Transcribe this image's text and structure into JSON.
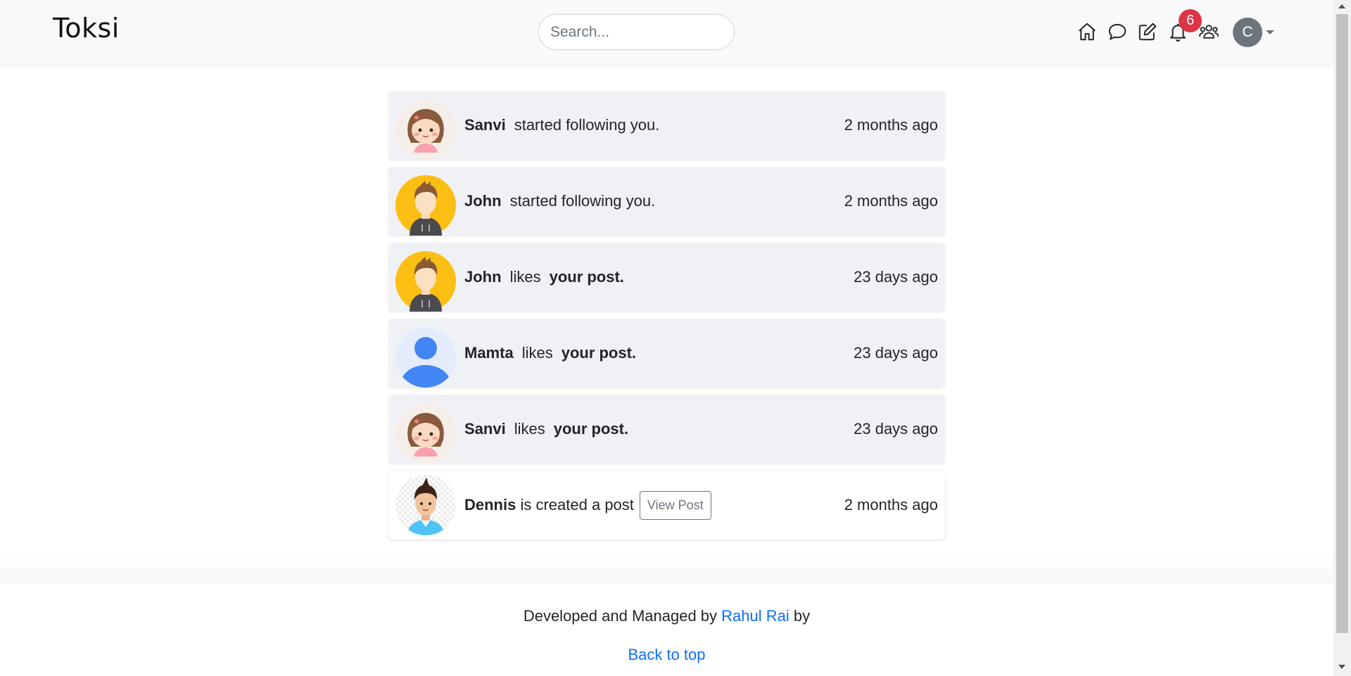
{
  "navbar": {
    "brand": "Toksi",
    "search_placeholder": "Search...",
    "icons": [
      "home-icon",
      "chat-icon",
      "edit-icon",
      "bell-icon",
      "people-icon"
    ],
    "notification_count": "6",
    "user_initial": "C"
  },
  "notifications": [
    {
      "name": "Sanvi",
      "action": "started following you.",
      "object": "",
      "time": "2 months ago",
      "avatar": "girl-avatar"
    },
    {
      "name": "John",
      "action": "started following you.",
      "object": "",
      "time": "2 months ago",
      "avatar": "boy-avatar"
    },
    {
      "name": "John",
      "action": "likes",
      "object": "your post.",
      "time": "23 days ago",
      "avatar": "boy-avatar"
    },
    {
      "name": "Mamta",
      "action": "likes",
      "object": "your post.",
      "time": "23 days ago",
      "avatar": "default-user-avatar"
    },
    {
      "name": "Sanvi",
      "action": "likes",
      "object": "your post.",
      "time": "23 days ago",
      "avatar": "girl-avatar"
    },
    {
      "name": "Dennis",
      "action": "is created a post",
      "button": "View Post",
      "time": "2 months ago",
      "avatar": "man-avatar"
    }
  ],
  "footer": {
    "prefix": "Developed and Managed by",
    "author": "Rahul Rai",
    "suffix": "by",
    "back_to_top": "Back to top"
  },
  "colors": {
    "brand_blue": "#0d6efd",
    "badge_red": "#dc3545",
    "card_bg": "#f0f1f4"
  }
}
